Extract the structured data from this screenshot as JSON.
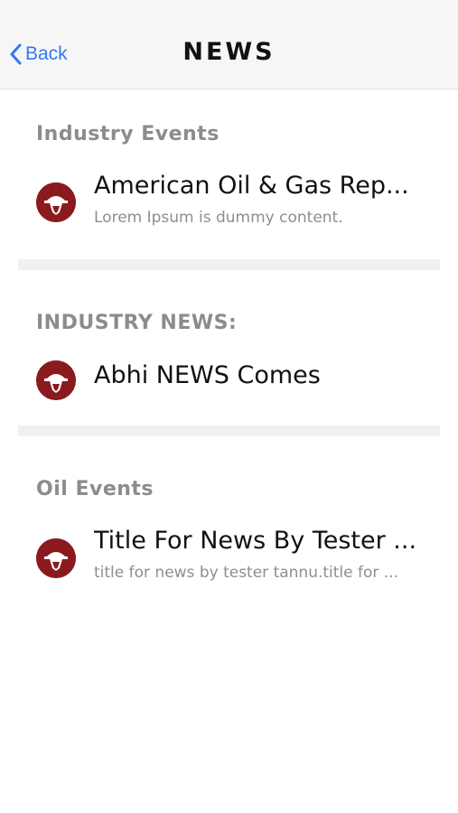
{
  "nav": {
    "back_label": "Back",
    "title": "NEWS"
  },
  "sections": [
    {
      "header": "Industry Events",
      "items": [
        {
          "title": "American Oil & Gas Rep...",
          "subtitle": "Lorem Ipsum is dummy content."
        }
      ]
    },
    {
      "header": "INDUSTRY NEWS:",
      "items": [
        {
          "title": "Abhi NEWS Comes",
          "subtitle": ""
        }
      ]
    },
    {
      "header": "Oil Events",
      "items": [
        {
          "title": "Title For News By Tester ...",
          "subtitle": "title for news by tester tannu.title for ..."
        }
      ]
    }
  ],
  "colors": {
    "accent": "#3478f6",
    "logo": "#8b1a1f",
    "section_header": "#8c8c8c"
  },
  "icons": {
    "back": "chevron-left-icon",
    "logo": "hardhat-logo-icon"
  }
}
